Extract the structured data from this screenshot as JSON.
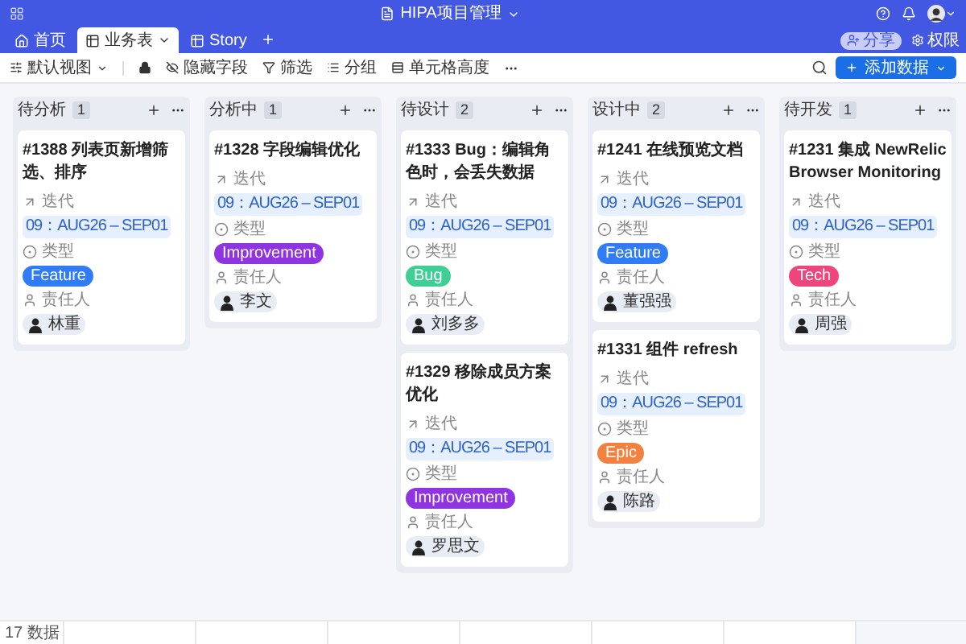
{
  "app": {
    "title": "HIPA项目管理"
  },
  "tabs": [
    {
      "label": "首页",
      "kind": "home",
      "selected": false
    },
    {
      "label": "业务表",
      "kind": "table",
      "selected": true
    },
    {
      "label": "Story",
      "kind": "table",
      "selected": false
    }
  ],
  "header_actions": [
    {
      "label": "分享",
      "kind": "share"
    },
    {
      "label": "权限",
      "kind": "permission"
    }
  ],
  "toolbar": {
    "view": "默认视图",
    "tools": [
      {
        "label": "隐藏字段",
        "kind": "hide"
      },
      {
        "label": "筛选",
        "kind": "filter"
      },
      {
        "label": "分组",
        "kind": "group"
      },
      {
        "label": "单元格高度",
        "kind": "height"
      }
    ],
    "add_button": "添加数据"
  },
  "board": {
    "columns": [
      {
        "name": "待分析",
        "count": "1",
        "cards": [
          {
            "title": "#1388 列表页新增筛选、排序",
            "iteration_label": "迭代",
            "iteration": "09：AUG26 – SEP01",
            "type_label": "类型",
            "type": "Feature",
            "color": "#2f7cf6",
            "owner_label": "责任人",
            "owner": "林重"
          }
        ]
      },
      {
        "name": "分析中",
        "count": "1",
        "cards": [
          {
            "title": "#1328 字段编辑优化",
            "iteration_label": "迭代",
            "iteration": "09：AUG26 – SEP01",
            "type_label": "类型",
            "type": "Improvement",
            "color": "#8f34e0",
            "owner_label": "责任人",
            "owner": "李文"
          }
        ]
      },
      {
        "name": "待设计",
        "count": "2",
        "cards": [
          {
            "title": "#1333 Bug：编辑角色时，会丢失数据",
            "iteration_label": "迭代",
            "iteration": "09：AUG26 – SEP01",
            "type_label": "类型",
            "type": "Bug",
            "color": "#3fcf94",
            "owner_label": "责任人",
            "owner": "刘多多"
          },
          {
            "title": "#1329 移除成员方案优化",
            "iteration_label": "迭代",
            "iteration": "09：AUG26 – SEP01",
            "type_label": "类型",
            "type": "Improvement",
            "color": "#8f34e0",
            "owner_label": "责任人",
            "owner": "罗思文"
          }
        ]
      },
      {
        "name": "设计中",
        "count": "2",
        "cards": [
          {
            "title": "#1241 在线预览文档",
            "iteration_label": "迭代",
            "iteration": "09：AUG26 – SEP01",
            "type_label": "类型",
            "type": "Feature",
            "color": "#2f7cf6",
            "owner_label": "责任人",
            "owner": "董强强"
          },
          {
            "title": "#1331 组件 refresh",
            "iteration_label": "迭代",
            "iteration": "09：AUG26 – SEP01",
            "type_label": "类型",
            "type": "Epic",
            "color": "#f28140",
            "owner_label": "责任人",
            "owner": "陈路"
          }
        ]
      },
      {
        "name": "待开发",
        "count": "1",
        "cards": [
          {
            "title": "#1231 集成 NewRelic Browser Monitoring",
            "iteration_label": "迭代",
            "iteration": "09：AUG26 – SEP01",
            "type_label": "类型",
            "type": "Tech",
            "color": "#f0447c",
            "owner_label": "责任人",
            "owner": "周强"
          }
        ]
      }
    ]
  },
  "footer": {
    "count": "17 数据"
  }
}
